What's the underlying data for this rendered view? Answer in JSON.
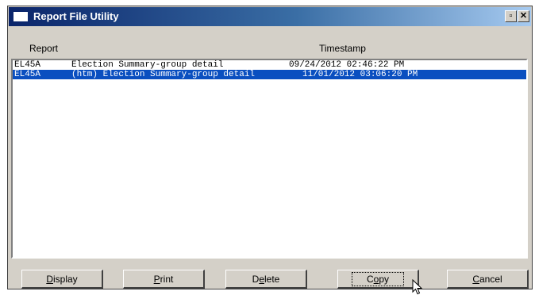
{
  "window": {
    "title": "Report File Utility",
    "restore_glyph": "▫",
    "close_glyph": "✕"
  },
  "columns": {
    "report": "Report",
    "timestamp": "Timestamp"
  },
  "reports": [
    {
      "code": "EL45A",
      "description": "Election Summary-group detail",
      "timestamp": "09/24/2012 02:46:22 PM",
      "selected": false
    },
    {
      "code": "EL45A",
      "description": "(htm) Election Summary-group detail",
      "timestamp": "11/01/2012 03:06:20 PM",
      "selected": true
    }
  ],
  "buttons": {
    "display": {
      "mnemonic": "D",
      "rest": "isplay"
    },
    "print": {
      "mnemonic": "P",
      "rest": "rint"
    },
    "delete": {
      "pre": "D",
      "mnemonic": "e",
      "rest": "lete"
    },
    "copy": {
      "pre": "C",
      "mnemonic": "o",
      "rest": "py"
    },
    "cancel": {
      "mnemonic": "C",
      "rest": "ancel"
    }
  },
  "colors": {
    "title_gradient_start": "#0a246a",
    "title_gradient_end": "#a6caf0",
    "selection": "#0a4fc0",
    "face": "#d4d0c8"
  },
  "icons": {
    "title": "window-icon",
    "restore": "restore-icon",
    "close": "close-icon",
    "cursor": "arrow-cursor-icon"
  }
}
